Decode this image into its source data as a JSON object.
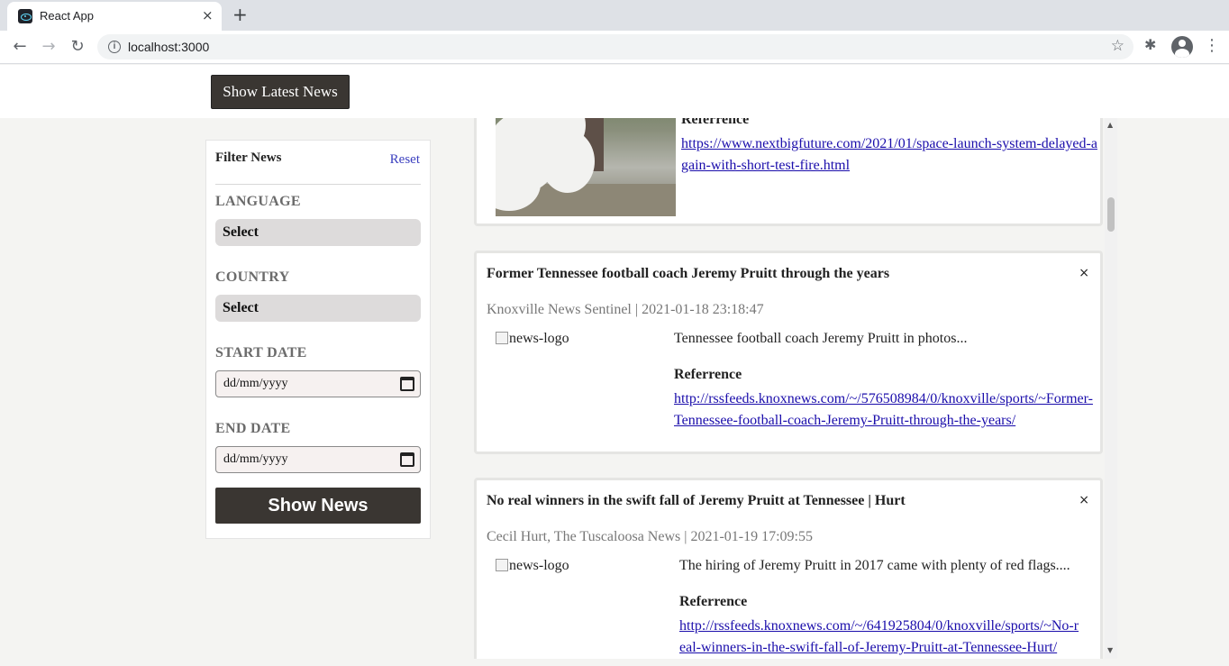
{
  "browser": {
    "tab_title": "React App",
    "tab_close_icon": "×",
    "new_tab_icon": "+",
    "url": "localhost:3000",
    "back_icon": "←",
    "forward_icon": "→",
    "reload_icon": "↻",
    "star_icon": "☆",
    "menu_icon": "⋮",
    "extensions_icon": "✱"
  },
  "header": {
    "latest_button": "Show Latest News"
  },
  "filter": {
    "title": "Filter News",
    "reset": "Reset",
    "language_label": "LANGUAGE",
    "language_value": "Select",
    "country_label": "COUNTRY",
    "country_value": "Select",
    "start_label": "START DATE",
    "start_placeholder": "dd/mm/yyyy",
    "end_label": "END DATE",
    "end_placeholder": "dd/mm/yyyy",
    "show_button": "Show News"
  },
  "news": [
    {
      "ref_label": "Referrence",
      "link": "https://www.nextbigfuture.com/2021/01/space-launch-system-delayed-again-with-short-test-fire.html"
    },
    {
      "title": "Former Tennessee football coach Jeremy Pruitt through the years",
      "close": "×",
      "meta": "Knoxville News Sentinel  | 2021-01-18 23:18:47",
      "logo_alt": "news-logo",
      "description": "Tennessee football coach Jeremy Pruitt in photos...",
      "ref_label": "Referrence",
      "link": "http://rssfeeds.knoxnews.com/~/576508984/0/knoxville/sports/~Former-Tennessee-football-coach-Jeremy-Pruitt-through-the-years/"
    },
    {
      "title": "No real winners in the swift fall of Jeremy Pruitt at Tennessee | Hurt",
      "close": "×",
      "meta": "Cecil Hurt, The Tuscaloosa News  | 2021-01-19 17:09:55",
      "logo_alt": "news-logo",
      "description": "The hiring of Jeremy Pruitt in 2017 came with plenty of red flags....",
      "ref_label": "Referrence",
      "link": "http://rssfeeds.knoxnews.com/~/641925804/0/knoxville/sports/~No-real-winners-in-the-swift-fall-of-Jeremy-Pruitt-at-Tennessee-Hurt/"
    }
  ],
  "colors": {
    "dark_button": "#3a3632",
    "link": "#1a0dab",
    "reset_link": "#3b3fbf"
  }
}
